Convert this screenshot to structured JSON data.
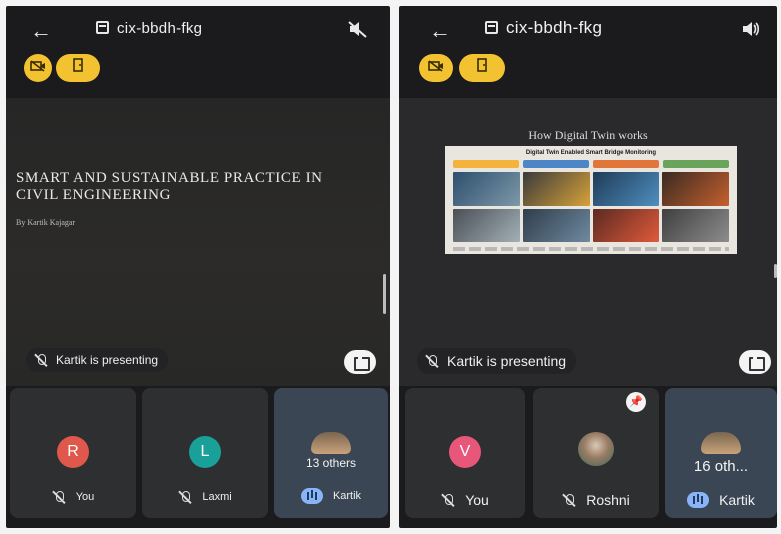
{
  "left": {
    "meeting_code": "cix-bbdh-fkg",
    "slide": {
      "title": "SMART AND SUSTAINABLE PRACTICE IN CIVIL ENGINEERING",
      "author": "By Kartik Kajagar"
    },
    "presenting_label": "Kartik is presenting",
    "tiles": [
      {
        "initial": "R",
        "name": "You",
        "avatar_color": "#e0584b"
      },
      {
        "initial": "L",
        "name": "Laxmi",
        "avatar_color": "#19a199"
      },
      {
        "others": "13 others",
        "name": "Kartik"
      }
    ]
  },
  "right": {
    "meeting_code": "cix-bbdh-fkg",
    "slide": {
      "heading": "How Digital Twin works",
      "infographic_title": "Digital Twin Enabled Smart Bridge Monitoring"
    },
    "presenting_label": "Kartik is presenting",
    "tiles": [
      {
        "initial": "V",
        "name": "You",
        "avatar_color": "#e8577a"
      },
      {
        "name": "Roshni"
      },
      {
        "others": "16 oth...",
        "name": "Kartik"
      }
    ]
  },
  "colors": {
    "chip": "#f2c230",
    "background": "#1b1b1d",
    "tile": "#2e2f31",
    "active_tile": "#3a4654",
    "speaking_indicator": "#8ab4f8"
  },
  "icons": [
    "back-arrow-icon",
    "calendar-icon",
    "speaker-off-icon",
    "speaker-icon",
    "camera-off-icon",
    "door-icon",
    "mic-off-icon",
    "fullscreen-icon",
    "pin-icon",
    "speaking-icon"
  ]
}
